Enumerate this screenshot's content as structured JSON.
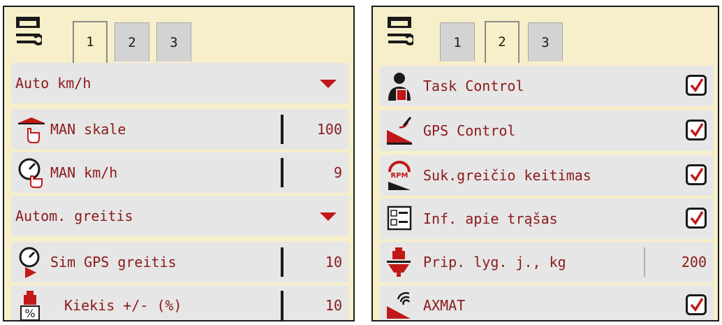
{
  "left_panel": {
    "tabs": [
      {
        "label": "1"
      },
      {
        "label": "2"
      },
      {
        "label": "3"
      }
    ],
    "active_tab": "1",
    "rows": [
      {
        "label": "Auto km/h",
        "control": "dropdown"
      },
      {
        "label": "MAN skale",
        "value": "100"
      },
      {
        "label": "MAN km/h",
        "value": "9"
      },
      {
        "label": "Autom. greitis",
        "control": "dropdown"
      },
      {
        "label": "Sim GPS greitis",
        "value": "10"
      },
      {
        "label": "Kiekis +/- (%)",
        "value": "10"
      }
    ]
  },
  "right_panel": {
    "tabs": [
      {
        "label": "1"
      },
      {
        "label": "2"
      },
      {
        "label": "3"
      }
    ],
    "active_tab": "2",
    "rows": [
      {
        "label": "Task Control",
        "checked": true
      },
      {
        "label": "GPS Control",
        "checked": true
      },
      {
        "label": "Suk.greičio keitimas",
        "checked": true
      },
      {
        "label": "Inf. apie trąšas",
        "checked": true
      },
      {
        "label": "Prip. lyg. j., kg",
        "value": "200"
      },
      {
        "label": "AXMAT",
        "checked": true
      }
    ]
  },
  "colors": {
    "panel_bg": "#f7efc9",
    "row_bg": "#e6e6e6",
    "text": "#8b1a1a",
    "accent": "#c21818",
    "tab_inactive": "#d3d3d3"
  },
  "icons": [
    "settings-wrench-icon",
    "speed-scale-icon",
    "speedometer-hand-icon",
    "speedometer-play-icon",
    "weight-percent-icon",
    "operator-task-icon",
    "gps-satellite-icon",
    "rpm-icon",
    "fertilizer-info-icon",
    "hopper-weight-icon",
    "axmat-sensor-icon"
  ]
}
